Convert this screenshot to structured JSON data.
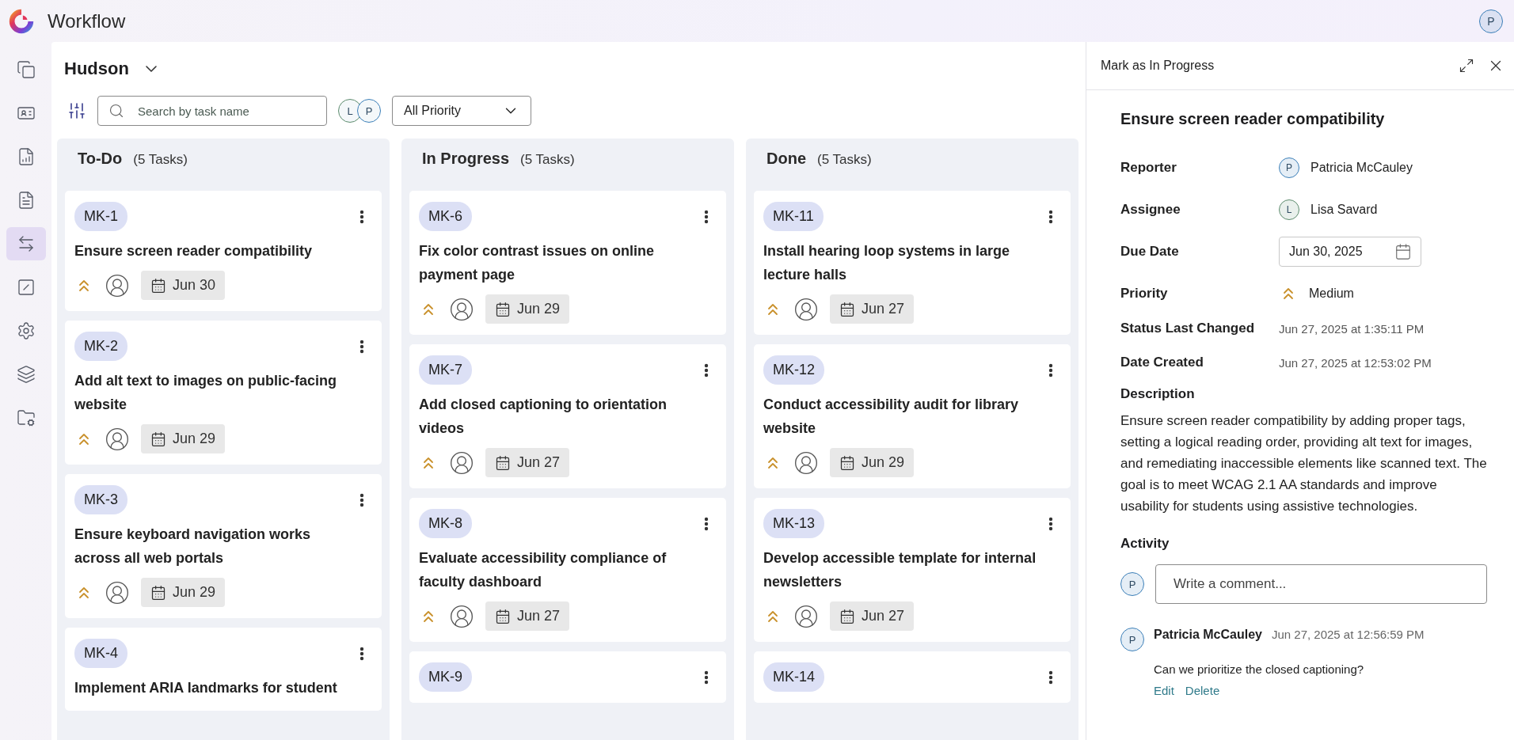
{
  "app": {
    "title": "Workflow",
    "user_initial": "P"
  },
  "sidebar": {
    "items": [
      {
        "selected": false
      },
      {
        "selected": false
      },
      {
        "selected": false
      },
      {
        "selected": false
      },
      {
        "selected": true
      },
      {
        "selected": false
      },
      {
        "selected": false
      },
      {
        "selected": false
      },
      {
        "selected": false
      }
    ]
  },
  "board": {
    "name": "Hudson",
    "search": {
      "placeholder": "Search by task name"
    },
    "members": [
      {
        "initial": "L",
        "color": "#5d8c6e"
      },
      {
        "initial": "P",
        "color": "#3b7fb8"
      }
    ],
    "priority_filter": "All Priority",
    "columns": [
      {
        "title": "To-Do",
        "count": "(5 Tasks)",
        "cards": [
          {
            "id": "MK-1",
            "title": "Ensure screen reader compatibility",
            "due": "Jun 30"
          },
          {
            "id": "MK-2",
            "title": "Add alt text to images on public-facing website",
            "due": "Jun 29"
          },
          {
            "id": "MK-3",
            "title": "Ensure keyboard navigation works across all web portals",
            "due": "Jun 29"
          },
          {
            "id": "MK-4",
            "title": "Implement ARIA landmarks for student"
          }
        ]
      },
      {
        "title": "In Progress",
        "count": "(5 Tasks)",
        "cards": [
          {
            "id": "MK-6",
            "title": "Fix color contrast issues on online payment page",
            "due": "Jun 29"
          },
          {
            "id": "MK-7",
            "title": "Add closed captioning to orientation videos",
            "due": "Jun 27"
          },
          {
            "id": "MK-8",
            "title": "Evaluate accessibility compliance of faculty dashboard",
            "due": "Jun 27"
          },
          {
            "id": "MK-9"
          }
        ]
      },
      {
        "title": "Done",
        "count": "(5 Tasks)",
        "cards": [
          {
            "id": "MK-11",
            "title": "Install hearing loop systems in large lecture halls",
            "due": "Jun 27"
          },
          {
            "id": "MK-12",
            "title": "Conduct accessibility audit for library website",
            "due": "Jun 29"
          },
          {
            "id": "MK-13",
            "title": "Develop accessible template for internal newsletters",
            "due": "Jun 27"
          },
          {
            "id": "MK-14"
          }
        ]
      }
    ]
  },
  "panel": {
    "action": "Mark as In Progress",
    "title": "Ensure screen reader compatibility",
    "fields": [
      {
        "kind": "person",
        "label": "Reporter",
        "initial": "P",
        "color": "#3b7fb8",
        "value": "Patricia McCauley"
      },
      {
        "kind": "person",
        "label": "Assignee",
        "initial": "L",
        "color": "#5d8c6e",
        "value": "Lisa Savard"
      },
      {
        "kind": "date",
        "label": "Due Date",
        "value": "Jun 30, 2025"
      },
      {
        "kind": "priority",
        "label": "Priority",
        "value": "Medium"
      },
      {
        "kind": "timestamp",
        "label": "Status Last Changed",
        "value": "Jun 27, 2025 at 1:35:11 PM"
      },
      {
        "kind": "timestamp",
        "label": "Date Created",
        "value": "Jun 27, 2025 at 12:53:02 PM"
      }
    ],
    "description": {
      "label": "Description",
      "text": "Ensure screen reader compatibility by adding proper tags, setting a logical reading order, providing alt text for images, and remediating inaccessible elements like scanned text. The goal is to meet WCAG 2.1 AA standards and improve usability for students using assistive technologies."
    },
    "activity": {
      "label": "Activity",
      "comment_box": {
        "initial": "P",
        "color": "#3b7fb8",
        "placeholder": "Write a comment..."
      },
      "comments": [
        {
          "initial": "P",
          "color": "#3b7fb8",
          "author": "Patricia McCauley",
          "time": "Jun 27, 2025 at 12:56:59 PM",
          "text": "Can we prioritize the closed captioning?",
          "actions": [
            "Edit",
            "Delete"
          ]
        }
      ]
    }
  }
}
